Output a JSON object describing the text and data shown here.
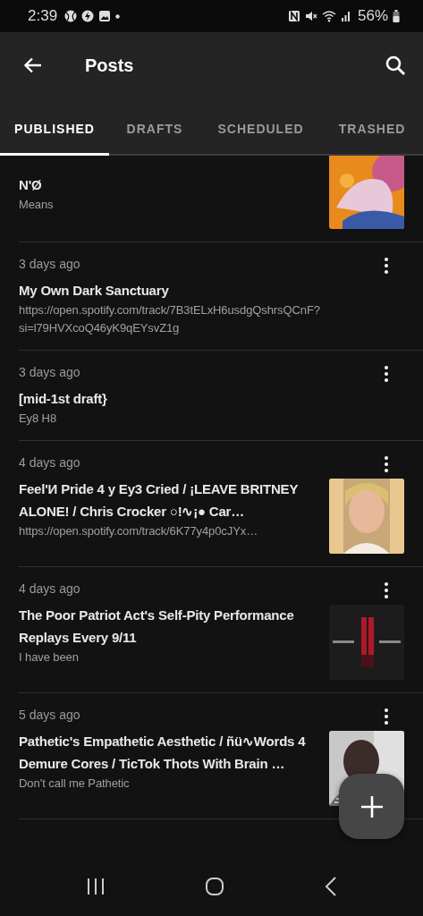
{
  "status_bar": {
    "time": "2:39",
    "battery": "56%"
  },
  "app_bar": {
    "title": "Posts"
  },
  "tabs": [
    {
      "label": "PUBLISHED",
      "selected": true
    },
    {
      "label": "DRAFTS",
      "selected": false
    },
    {
      "label": "SCHEDULED",
      "selected": false
    },
    {
      "label": "TRASHED",
      "selected": false
    }
  ],
  "posts": [
    {
      "title": "N'Ø",
      "body": "Means",
      "has_thumbnail": true,
      "menu": false
    },
    {
      "date": "3 days ago",
      "title": "My Own Dark Sanctuary",
      "body": "https://open.spotify.com/track/7B3tELxH6usdgQshrsQCnF?si=l79HVXcoQ46yK9qEYsvZ1g",
      "has_thumbnail": false,
      "menu": true
    },
    {
      "date": "3 days ago",
      "title": "[mid-1st draft}",
      "body": "Ey8 H8",
      "has_thumbnail": false,
      "menu": true
    },
    {
      "date": "4 days ago",
      "title": "Feel'И Pride 4 y Ey3 Cried / ¡LEAVE BRITNEY ALONE! / Chris Crocker ○!∿¡● Car…",
      "body": "https://open.spotify.com/track/6K77y4p0cJYx…",
      "has_thumbnail": true,
      "menu": true
    },
    {
      "date": "4 days ago",
      "title": "The Poor Patriot Act's Self-Pity Performance Replays Every 9/11",
      "body": "I have been",
      "has_thumbnail": true,
      "menu": true
    },
    {
      "date": "5 days ago",
      "title": "Pathetic's Empathetic Aesthetic / ñü∿Words 4 Demure Cores / TicTok Thots With Brain …",
      "body": "Don’t call me Pathetic",
      "has_thumbnail": true,
      "menu": true
    }
  ]
}
